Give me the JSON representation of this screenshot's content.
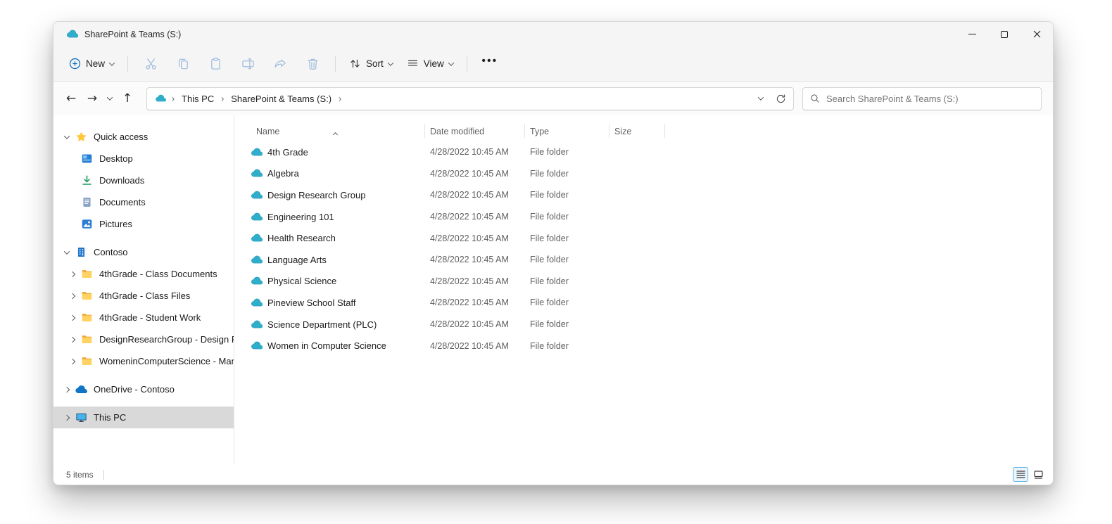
{
  "window": {
    "title": "SharePoint & Teams (S:)",
    "status_items": "5 items"
  },
  "toolbar": {
    "new_label": "New",
    "sort_label": "Sort",
    "view_label": "View",
    "more_label": "•••",
    "disabled_icons": [
      "cut",
      "copy",
      "paste",
      "rename",
      "share",
      "delete"
    ]
  },
  "navigation": {
    "breadcrumb_root": "This PC",
    "breadcrumb_current": "SharePoint & Teams (S:)"
  },
  "search": {
    "placeholder": "Search SharePoint & Teams (S:)"
  },
  "sidebar": {
    "items": [
      {
        "label": "Quick access",
        "icon": "star-icon",
        "expander": "down",
        "level": 0,
        "selected": false,
        "group_gap": false
      },
      {
        "label": "Desktop",
        "icon": "desktop-icon",
        "expander": "none",
        "level": 1,
        "selected": false,
        "group_gap": false
      },
      {
        "label": "Downloads",
        "icon": "downloads-icon",
        "expander": "none",
        "level": 1,
        "selected": false,
        "group_gap": false
      },
      {
        "label": "Documents",
        "icon": "documents-icon",
        "expander": "none",
        "level": 1,
        "selected": false,
        "group_gap": false
      },
      {
        "label": "Pictures",
        "icon": "pictures-icon",
        "expander": "none",
        "level": 1,
        "selected": false,
        "group_gap": false
      },
      {
        "label": "Contoso",
        "icon": "building-icon",
        "expander": "down",
        "level": 0,
        "selected": false,
        "group_gap": true
      },
      {
        "label": "4thGrade - Class Documents",
        "icon": "folder-icon",
        "expander": "right",
        "level": 1,
        "selected": false,
        "group_gap": false
      },
      {
        "label": "4thGrade - Class Files",
        "icon": "folder-icon",
        "expander": "right",
        "level": 1,
        "selected": false,
        "group_gap": false
      },
      {
        "label": "4thGrade - Student Work",
        "icon": "folder-icon",
        "expander": "right",
        "level": 1,
        "selected": false,
        "group_gap": false
      },
      {
        "label": "DesignResearchGroup - Design Resea",
        "icon": "folder-icon",
        "expander": "right",
        "level": 1,
        "selected": false,
        "group_gap": false
      },
      {
        "label": "WomeninComputerScience - Manage",
        "icon": "folder-icon",
        "expander": "right",
        "level": 1,
        "selected": false,
        "group_gap": false
      },
      {
        "label": "OneDrive - Contoso",
        "icon": "onedrive-icon",
        "expander": "right",
        "level": 0,
        "selected": false,
        "group_gap": true
      },
      {
        "label": "This PC",
        "icon": "thispc-icon",
        "expander": "right",
        "level": 0,
        "selected": true,
        "group_gap": true
      }
    ]
  },
  "files": {
    "columns": [
      "Name",
      "Date modified",
      "Type",
      "Size"
    ],
    "sort_column": "Name",
    "sort_direction": "ascending",
    "rows": [
      {
        "name": "4th Grade",
        "date_modified": "4/28/2022 10:45 AM",
        "type": "File folder",
        "size": ""
      },
      {
        "name": "Algebra",
        "date_modified": "4/28/2022 10:45 AM",
        "type": "File folder",
        "size": ""
      },
      {
        "name": "Design Research Group",
        "date_modified": "4/28/2022 10:45 AM",
        "type": "File folder",
        "size": ""
      },
      {
        "name": "Engineering 101",
        "date_modified": "4/28/2022 10:45 AM",
        "type": "File folder",
        "size": ""
      },
      {
        "name": "Health Research",
        "date_modified": "4/28/2022 10:45 AM",
        "type": "File folder",
        "size": ""
      },
      {
        "name": "Language Arts",
        "date_modified": "4/28/2022 10:45 AM",
        "type": "File folder",
        "size": ""
      },
      {
        "name": "Physical Science",
        "date_modified": "4/28/2022 10:45 AM",
        "type": "File folder",
        "size": ""
      },
      {
        "name": "Pineview School Staff",
        "date_modified": "4/28/2022 10:45 AM",
        "type": "File folder",
        "size": ""
      },
      {
        "name": "Science Department (PLC)",
        "date_modified": "4/28/2022 10:45 AM",
        "type": "File folder",
        "size": ""
      },
      {
        "name": "Women in Computer Science",
        "date_modified": "4/28/2022 10:45 AM",
        "type": "File folder",
        "size": ""
      }
    ]
  },
  "colors": {
    "accent_blue": "#0067c0",
    "sharepoint_teal": "#2fadc9",
    "onedrive_blue": "#1173c5",
    "folder_yellow": "#ffd262",
    "chrome_gray": "#f5f5f5",
    "selected_gray": "#d9d9d9",
    "disabled_icon_blue": "#a3c0de"
  }
}
